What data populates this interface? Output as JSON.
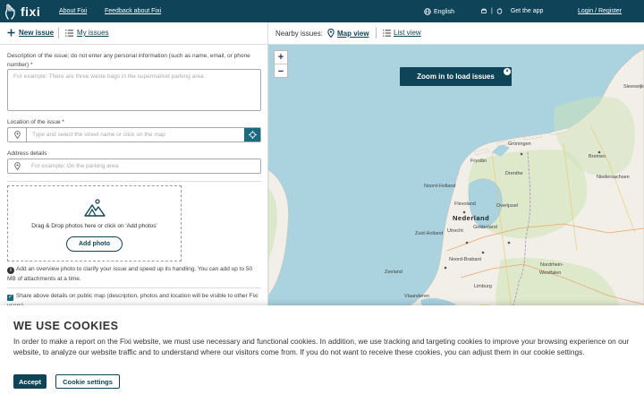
{
  "header": {
    "logo_text": "fixi",
    "about": "About Fixi",
    "feedback": "Feedback about Fixi",
    "language": "English",
    "app_separator": "|",
    "get_app": "Get the app",
    "login": "Login / Register",
    "bg_color": "#0f4458"
  },
  "tabs": {
    "new_issue": "New issue",
    "my_issues": "My issues"
  },
  "form": {
    "description_label": "Description of the issue; do not enter any personal information (such as name, email, or phone number) *",
    "description_placeholder": "For example: There are three waste bags in the supermarket parking area",
    "location_label": "Location of the issue *",
    "location_placeholder": "Type and select the street name or click on the map",
    "address_label": "Address details",
    "address_placeholder": "For example: On the parking area",
    "dropzone_text": "Drag & Drop photos here or click on 'Add photos'",
    "add_photo": "Add photo",
    "info_text": "Add an overview photo to clarify your issue and speed up its handling. You can add up to 50 MB of attachments at a time.",
    "share_text": "Share above details on public map (description, photos and location will be visible to other Fixi users)"
  },
  "map_bar": {
    "nearby": "Nearby issues:",
    "map_view": "Map view",
    "list_view": "List view"
  },
  "map": {
    "zoom_in": "+",
    "zoom_out": "−",
    "zoom_message": "Zoom in to load issues",
    "close": "×",
    "labels": {
      "sleeswijk": "Sleeswijk",
      "groningen": "Groningen",
      "friesland": "Fryslân",
      "drenthe": "Drenthe",
      "bremen": "Bremen",
      "niedersachsen": "Niedersachsen",
      "noord_holland": "Noord-Holland",
      "flevoland": "Flevoland",
      "overijssel": "Overijssel",
      "nederland": "Nederland",
      "zuid_holland": "Zuid-Holland",
      "utrecht": "Utrecht",
      "gelderland": "Gelderland",
      "noord_brabant": "Noord-Brabant",
      "nordrhein": "Nordrhein-",
      "westfalen": "Westfalen",
      "zeeland": "Zeeland",
      "vlaanderen": "Vlaanderen",
      "limburg": "Limburg"
    },
    "colors": {
      "water": "#aad3df",
      "land": "#f2efe9",
      "green": "#cde3b5",
      "accent": "#1a6a82"
    }
  },
  "cookie": {
    "title": "WE USE COOKIES",
    "text": "In order to make a report on the Fixi website, we must use necessary and functional cookies. In addition, we use tracking and targeting cookies to improve your browsing experience on our website, to analyze our website traffic and to understand where our visitors come from. If you do not want to receive these cookies, you can adjust them in our cookie settings.",
    "accept": "Accept",
    "settings": "Cookie settings"
  }
}
